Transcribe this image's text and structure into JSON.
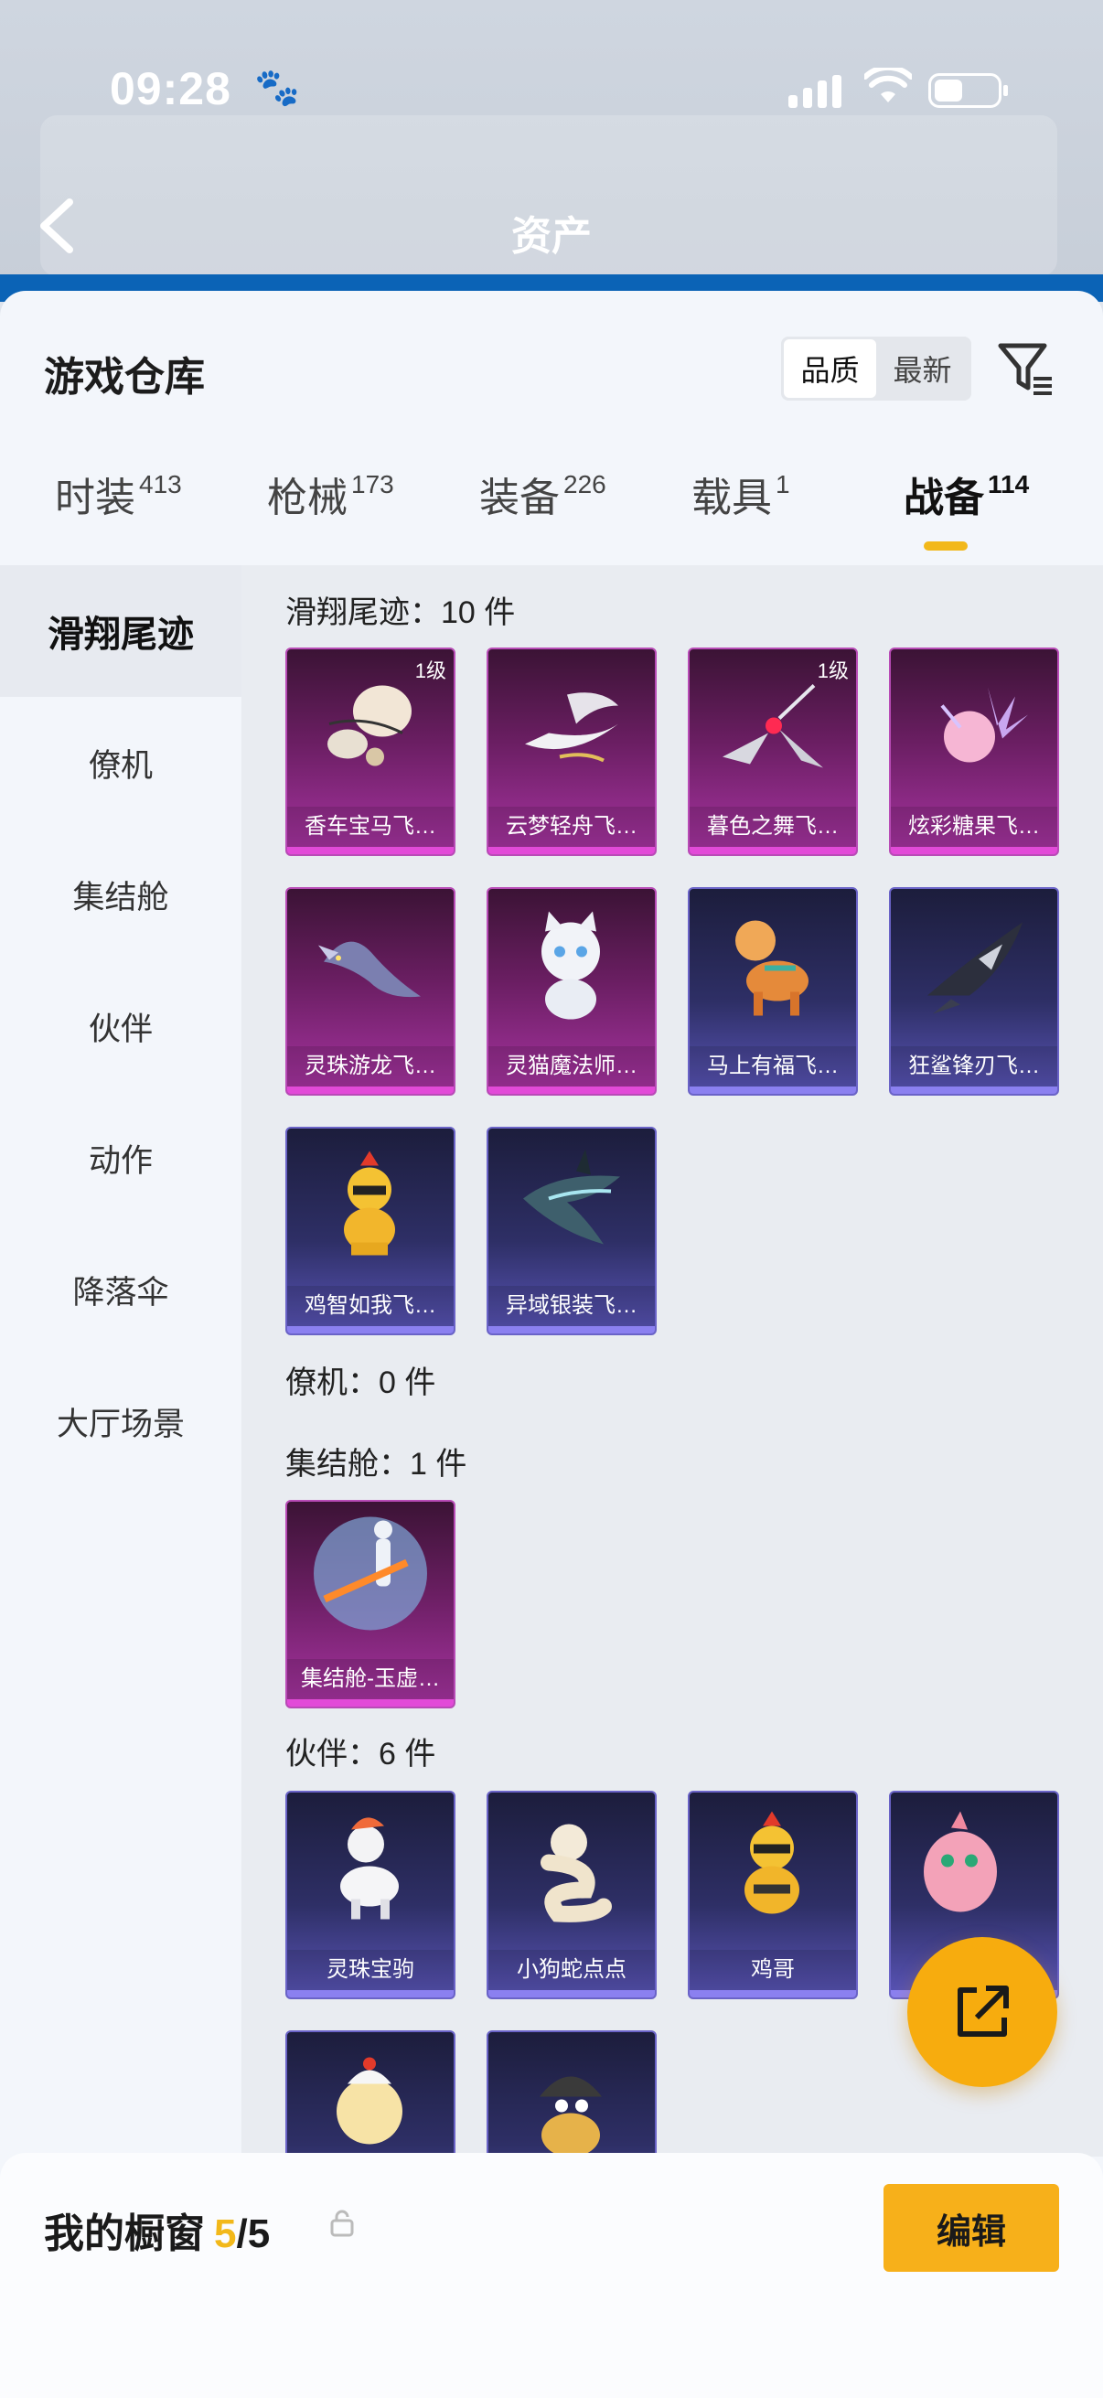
{
  "status": {
    "time": "09:28"
  },
  "header": {
    "title": "资产"
  },
  "sheet": {
    "title": "游戏仓库",
    "sort": {
      "quality": "品质",
      "latest": "最新"
    }
  },
  "tabs": [
    {
      "label": "时装",
      "count": "413"
    },
    {
      "label": "枪械",
      "count": "173"
    },
    {
      "label": "装备",
      "count": "226"
    },
    {
      "label": "载具",
      "count": "1"
    },
    {
      "label": "战备",
      "count": "114"
    }
  ],
  "sidebar": [
    {
      "label": "滑翔尾迹"
    },
    {
      "label": "僚机"
    },
    {
      "label": "集结舱"
    },
    {
      "label": "伙伴"
    },
    {
      "label": "动作"
    },
    {
      "label": "降落伞"
    },
    {
      "label": "大厅场景"
    }
  ],
  "sections": {
    "glide": {
      "label": "滑翔尾迹：10 件",
      "items": [
        {
          "name": "香车宝马飞…",
          "level": "1级"
        },
        {
          "name": "云梦轻舟飞…"
        },
        {
          "name": "暮色之舞飞…",
          "level": "1级"
        },
        {
          "name": "炫彩糖果飞…"
        },
        {
          "name": "灵珠游龙飞…"
        },
        {
          "name": "灵猫魔法师…"
        },
        {
          "name": "马上有福飞…"
        },
        {
          "name": "狂鲨锋刃飞…"
        },
        {
          "name": "鸡智如我飞…"
        },
        {
          "name": "异域银装飞…"
        }
      ]
    },
    "wingman": {
      "label": "僚机：0 件"
    },
    "capsule": {
      "label": "集结舱：1 件",
      "items": [
        {
          "name": "集结舱-玉虚…"
        }
      ]
    },
    "partner": {
      "label": "伙伴：6 件",
      "items": [
        {
          "name": "灵珠宝驹"
        },
        {
          "name": "小狗蛇点点"
        },
        {
          "name": "鸡哥"
        }
      ]
    }
  },
  "bottom": {
    "label": "我的橱窗",
    "count_current": "5",
    "count_total": "/5",
    "edit": "编辑"
  }
}
